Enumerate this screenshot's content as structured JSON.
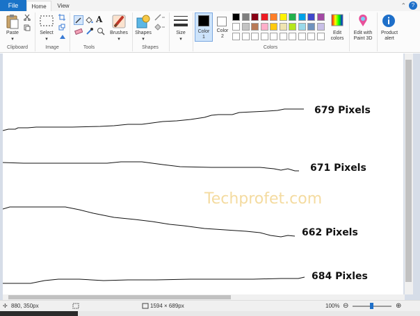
{
  "tabs": {
    "file": "File",
    "home": "Home",
    "view": "View"
  },
  "ribbon": {
    "clipboard": {
      "paste_label": "Paste",
      "group_label": "Clipboard"
    },
    "image": {
      "select_label": "Select",
      "group_label": "Image"
    },
    "tools": {
      "group_label": "Tools"
    },
    "brushes": {
      "label": "Brushes"
    },
    "shapes": {
      "label": "Shapes",
      "group_label": "Shapes"
    },
    "size": {
      "label": "Size"
    },
    "color1": {
      "label_line1": "Color",
      "label_line2": "1"
    },
    "color2": {
      "label_line1": "Color",
      "label_line2": "2"
    },
    "colors": {
      "group_label": "Colors",
      "row1": [
        "#000000",
        "#7f7f7f",
        "#880015",
        "#ed1c24",
        "#ff7f27",
        "#fff200",
        "#22b14c",
        "#00a2e8",
        "#3f48cc",
        "#a349a4"
      ],
      "row2": [
        "#ffffff",
        "#c3c3c3",
        "#b97a57",
        "#ffaec9",
        "#ffc90e",
        "#efe4b0",
        "#b5e61d",
        "#99d9ea",
        "#7092be",
        "#c8bfe7"
      ],
      "row3": [
        "#ffffff",
        "#ffffff",
        "#ffffff",
        "#ffffff",
        "#ffffff",
        "#ffffff",
        "#ffffff",
        "#ffffff",
        "#ffffff",
        "#ffffff"
      ]
    },
    "edit_colors": {
      "line1": "Edit",
      "line2": "colors"
    },
    "paint3d": {
      "line1": "Edit with",
      "line2": "Paint 3D"
    },
    "product_alert": {
      "line1": "Product",
      "line2": "alert"
    }
  },
  "canvas": {
    "labels": [
      "679 Pixels",
      "671 Pixels",
      "662 Pixels",
      "684 Pixles"
    ],
    "watermark": "Techprofet.com"
  },
  "status": {
    "cursor_pos": "880, 350px",
    "image_size": "1594 × 689px",
    "zoom": "100%"
  },
  "colors": {
    "file_tab": "#1a73c8",
    "workspace": "#d6dde8",
    "help": "#1e6fc9"
  }
}
